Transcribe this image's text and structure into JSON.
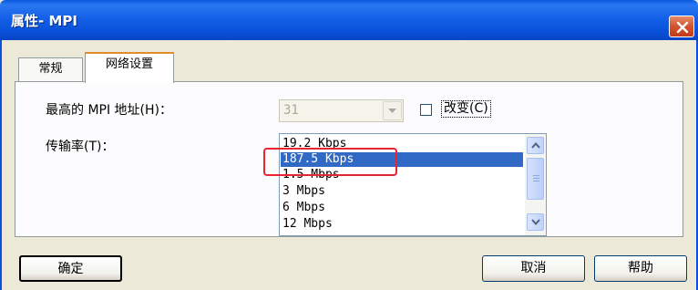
{
  "window": {
    "title": "属性- MPI"
  },
  "tabs": [
    {
      "label": "常规"
    },
    {
      "label": "网络设置"
    }
  ],
  "fields": {
    "highest_mpi_label": "最高的 MPI 地址(H)：",
    "highest_mpi_value": "31",
    "change_checkbox_label": "改变(C)",
    "change_checked": false,
    "rate_label": "传输率(T)："
  },
  "rate_options": [
    "19.2 Kbps",
    "187.5 Kbps",
    "1.5 Mbps",
    "3 Mbps",
    "6 Mbps",
    "12 Mbps"
  ],
  "rate_selected": "187.5 Kbps",
  "buttons": {
    "ok": "确定",
    "cancel": "取消",
    "help": "帮助"
  },
  "icons": {
    "close": "close-icon",
    "dropdown": "chevron-down-icon",
    "scroll_up": "arrow-up-icon",
    "scroll_down": "arrow-down-icon"
  },
  "colors": {
    "titlebar": "#0A50D8",
    "selection": "#316AC5",
    "highlight": "#E8252F"
  }
}
